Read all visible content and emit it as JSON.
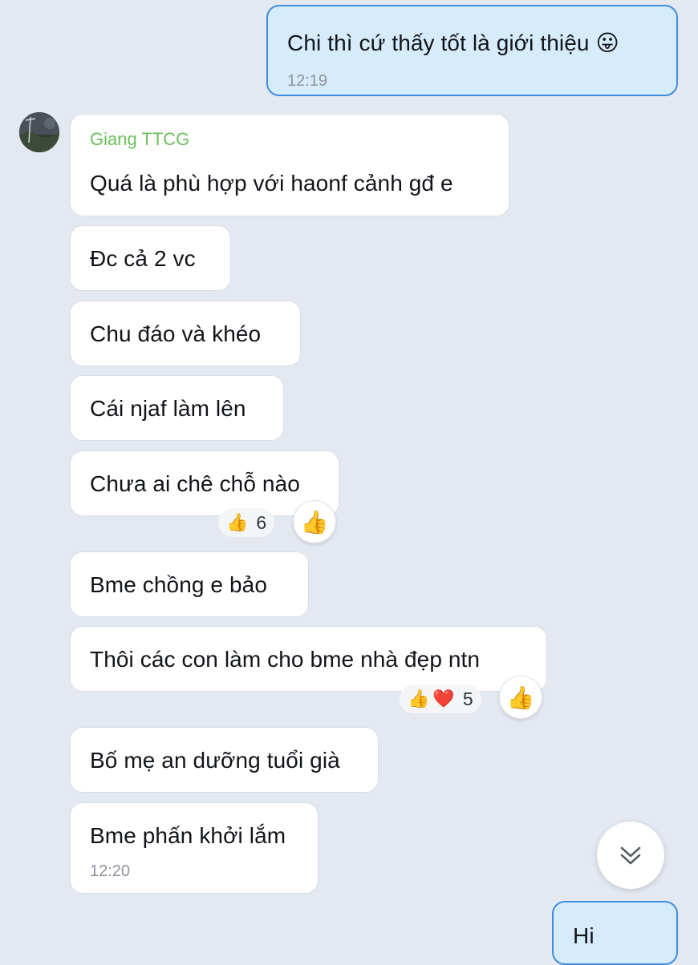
{
  "chat": {
    "outgoing_top": {
      "text": "Chi thì cứ thấy tốt là giới thiệu 😛",
      "time": "12:19"
    },
    "sender_name": "Giang TTCG",
    "messages": [
      {
        "text": "Quá là phù hợp với haonf cảnh gđ e"
      },
      {
        "text": "Đc cả 2 vc"
      },
      {
        "text": "Chu đáo và khéo"
      },
      {
        "text": "Cái njaf làm lên"
      },
      {
        "text": "Chưa ai chê chỗ nào"
      },
      {
        "text": "Bme chồng e bảo"
      },
      {
        "text": "Thôi các con làm cho bme nhà đẹp ntn"
      },
      {
        "text": "Bố mẹ an dưỡng tuổi già"
      },
      {
        "text": "Bme phấn khởi lắm",
        "time": "12:20"
      }
    ],
    "reactions": {
      "msg5": {
        "emojis": [
          "👍"
        ],
        "count": "6",
        "action_emoji": "👍"
      },
      "msg7": {
        "emojis": [
          "👍",
          "❤️"
        ],
        "count": "5",
        "action_emoji": "👍"
      }
    },
    "outgoing_bottom_partial": "Hi"
  },
  "icons": {
    "scroll_down": "double-chevron-down-icon",
    "avatar": "user-avatar"
  },
  "colors": {
    "background": "#e4e8f0",
    "outgoing_bubble": "#d6ecfb",
    "outgoing_border": "#3f8de0",
    "incoming_bubble": "#ffffff",
    "sender_name": "#6bbf5c",
    "time_text": "#8f949c"
  }
}
